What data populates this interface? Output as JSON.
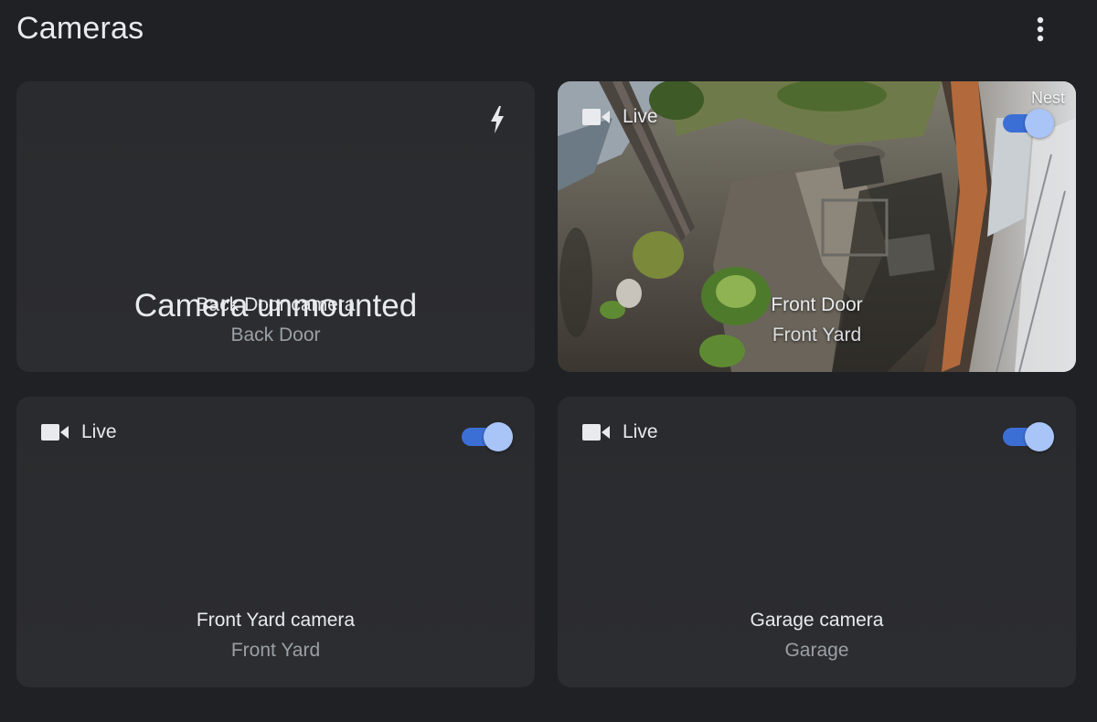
{
  "header": {
    "title": "Cameras",
    "menu_icon": "more-vert-icon"
  },
  "cameras": [
    {
      "status_text": "Camera unmounted",
      "title": "Back Door camera",
      "room": "Back Door",
      "icon": "bolt-icon"
    },
    {
      "live_label": "Live",
      "brand": "Nest",
      "title": "Front Door",
      "room": "Front Yard",
      "live_on": true,
      "icon": "videocam-icon"
    },
    {
      "live_label": "Live",
      "title": "Front Yard camera",
      "room": "Front Yard",
      "live_on": true,
      "icon": "videocam-icon"
    },
    {
      "live_label": "Live",
      "title": "Garage camera",
      "room": "Garage",
      "live_on": true,
      "icon": "videocam-icon"
    }
  ],
  "colors": {
    "background": "#202124",
    "card": "#2b2c2f",
    "toggle_track": "#3c6fd6",
    "toggle_knob": "#a9c4f7",
    "text_primary": "#e8eaed",
    "text_secondary": "#9aa0a6"
  }
}
